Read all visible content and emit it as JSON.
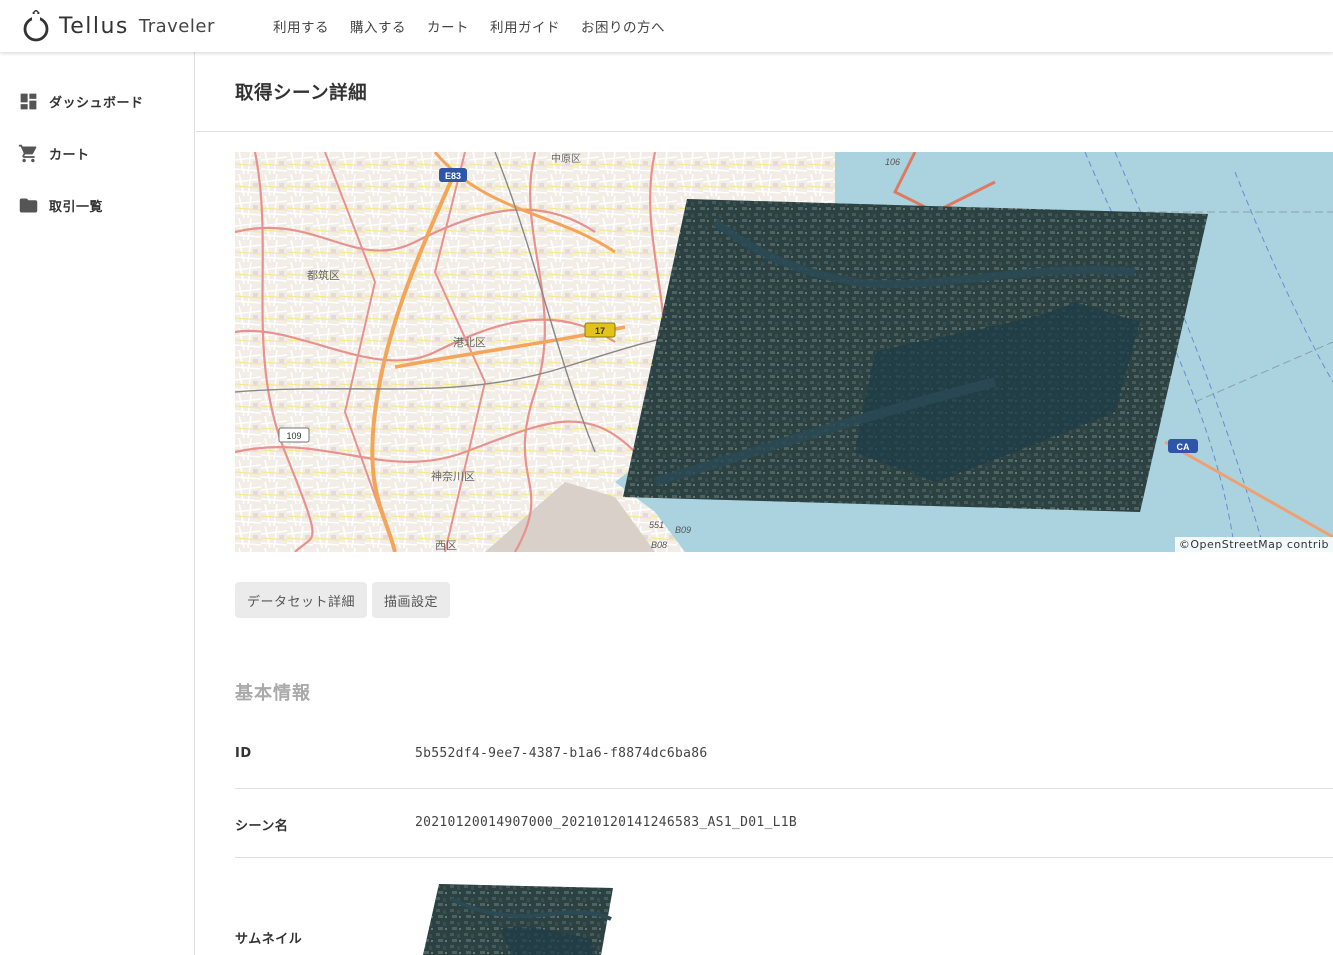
{
  "app": {
    "brand": "Tellus",
    "product": "Traveler"
  },
  "nav": {
    "items": [
      "利用する",
      "購入する",
      "カート",
      "利用ガイド",
      "お困りの方へ"
    ]
  },
  "sidebar": {
    "items": [
      {
        "label": "ダッシュボード",
        "icon": "dashboard-icon"
      },
      {
        "label": "カート",
        "icon": "cart-icon"
      },
      {
        "label": "取引一覧",
        "icon": "folder-icon"
      }
    ]
  },
  "page": {
    "title": "取得シーン詳細"
  },
  "map": {
    "attribution": "©OpenStreetMap contrib",
    "labels": {
      "e83": "E83",
      "r17": "17",
      "r109": "109",
      "r106": "106",
      "ca": "CA",
      "r551": "551",
      "b09": "B09",
      "b08": "B08",
      "tsuzuki": "都筑区",
      "kohoku": "港北区",
      "kanagawa": "神奈川区",
      "nishi": "西区",
      "nakahara": "中原区"
    }
  },
  "buttons": {
    "dataset_detail": "データセット詳細",
    "render_settings": "描画設定"
  },
  "basic_info": {
    "section_title": "基本情報",
    "id_label": "ID",
    "id_value": "5b552df4-9ee7-4387-b1a6-f8874dc6ba86",
    "scene_label": "シーン名",
    "scene_value": "20210120014907000_20210120141246583_AS1_D01_L1B",
    "thumb_label": "サムネイル"
  }
}
